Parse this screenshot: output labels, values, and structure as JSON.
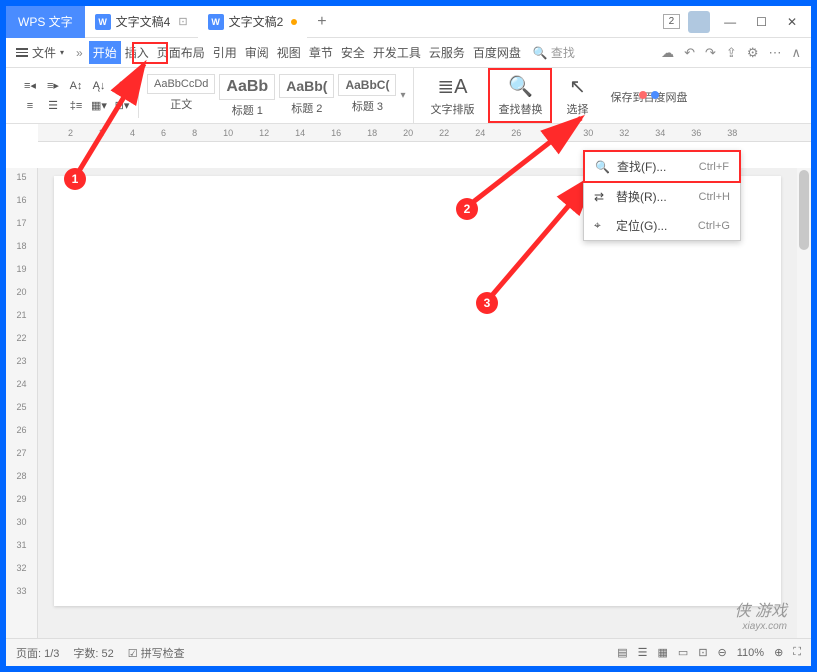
{
  "app": {
    "name": "WPS 文字"
  },
  "tabs": [
    {
      "label": "文字文稿4",
      "active": false
    },
    {
      "label": "文字文稿2",
      "active": true,
      "modified": true
    }
  ],
  "titlebar": {
    "counter": "2",
    "plus": "+"
  },
  "menu": {
    "file": "文件",
    "items": [
      "开始",
      "插入",
      "页面布局",
      "引用",
      "审阅",
      "视图",
      "章节",
      "安全",
      "开发工具",
      "云服务",
      "百度网盘"
    ],
    "search": "查找"
  },
  "styles": [
    {
      "preview": "AaBbCcDd",
      "label": "正文"
    },
    {
      "preview": "AaBb",
      "label": "标题 1"
    },
    {
      "preview": "AaBb(",
      "label": "标题 2"
    },
    {
      "preview": "AaBbC(",
      "label": "标题 3"
    }
  ],
  "ribbon_right": {
    "style_btn": "文字排版",
    "find_replace": "查找替换",
    "select": "选择",
    "save_cloud": "保存到百度网盘"
  },
  "dropdown": [
    {
      "icon": "search",
      "label": "查找(F)...",
      "shortcut": "Ctrl+F"
    },
    {
      "icon": "replace",
      "label": "替换(R)...",
      "shortcut": "Ctrl+H"
    },
    {
      "icon": "goto",
      "label": "定位(G)...",
      "shortcut": "Ctrl+G"
    }
  ],
  "ruler_h": [
    "2",
    "",
    "2",
    "4",
    "6",
    "8",
    "10",
    "12",
    "14",
    "16",
    "18",
    "20",
    "22",
    "24",
    "26",
    "28",
    "30",
    "32",
    "34",
    "36",
    "38"
  ],
  "ruler_v": [
    "15",
    "16",
    "17",
    "18",
    "19",
    "20",
    "21",
    "22",
    "23",
    "24",
    "25",
    "26",
    "27",
    "28",
    "29",
    "30",
    "31",
    "32",
    "33"
  ],
  "status": {
    "page": "页面: 1/3",
    "words": "字数: 52",
    "spell": "拼写检查",
    "zoom": "110%"
  },
  "markers": [
    "1",
    "2",
    "3"
  ],
  "watermark": {
    "main": "侠 游戏",
    "sub": "xiayx.com"
  }
}
